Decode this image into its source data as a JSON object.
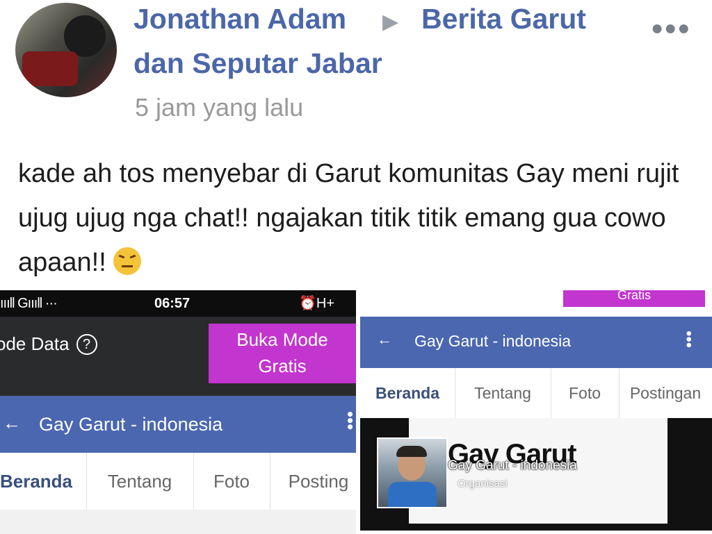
{
  "post": {
    "author": "Jonathan Adam",
    "group_line1": "Berita Garut",
    "group_line2": "dan Seputar Jabar",
    "timestamp": "5 jam yang lalu",
    "body": "kade ah tos menyebar di Garut komunitas Gay meni rujit ujug ujug nga chat!! ngajakan titik titik emang gua cowo apaan!!"
  },
  "screenshot1": {
    "status": {
      "signal": "ıııll Gıııll ···",
      "time": "06:57",
      "icons": "⏰H+"
    },
    "banner": {
      "mode_label": "ode Data",
      "help": "?",
      "buka_line1": "Buka Mode",
      "buka_line2": "Gratis"
    },
    "bar": {
      "back": "←",
      "title": "Gay Garut - indonesia",
      "menu": "⋮"
    },
    "tabs": [
      "Beranda",
      "Tentang",
      "Foto",
      "Posting"
    ]
  },
  "screenshot2": {
    "gratis": "Gratis",
    "bar": {
      "back": "←",
      "title": "Gay Garut - indonesia",
      "menu": "⋮"
    },
    "tabs": [
      "Beranda",
      "Tentang",
      "Foto",
      "Postingan"
    ],
    "cover": {
      "big_title": "Gay Garut",
      "page_name": "Gay Garut - indonesia",
      "category": "Organisasi"
    }
  },
  "colors": {
    "link_blue": "#4b67a8",
    "appbar_blue": "#4b67b0",
    "promo_purple": "#c235ce"
  },
  "icons": [
    "avatar-photo",
    "triangle-arrow-icon",
    "more-dots-icon",
    "angry-face-emoji",
    "help-circle-icon",
    "back-arrow-icon",
    "vertical-dots-icon"
  ]
}
